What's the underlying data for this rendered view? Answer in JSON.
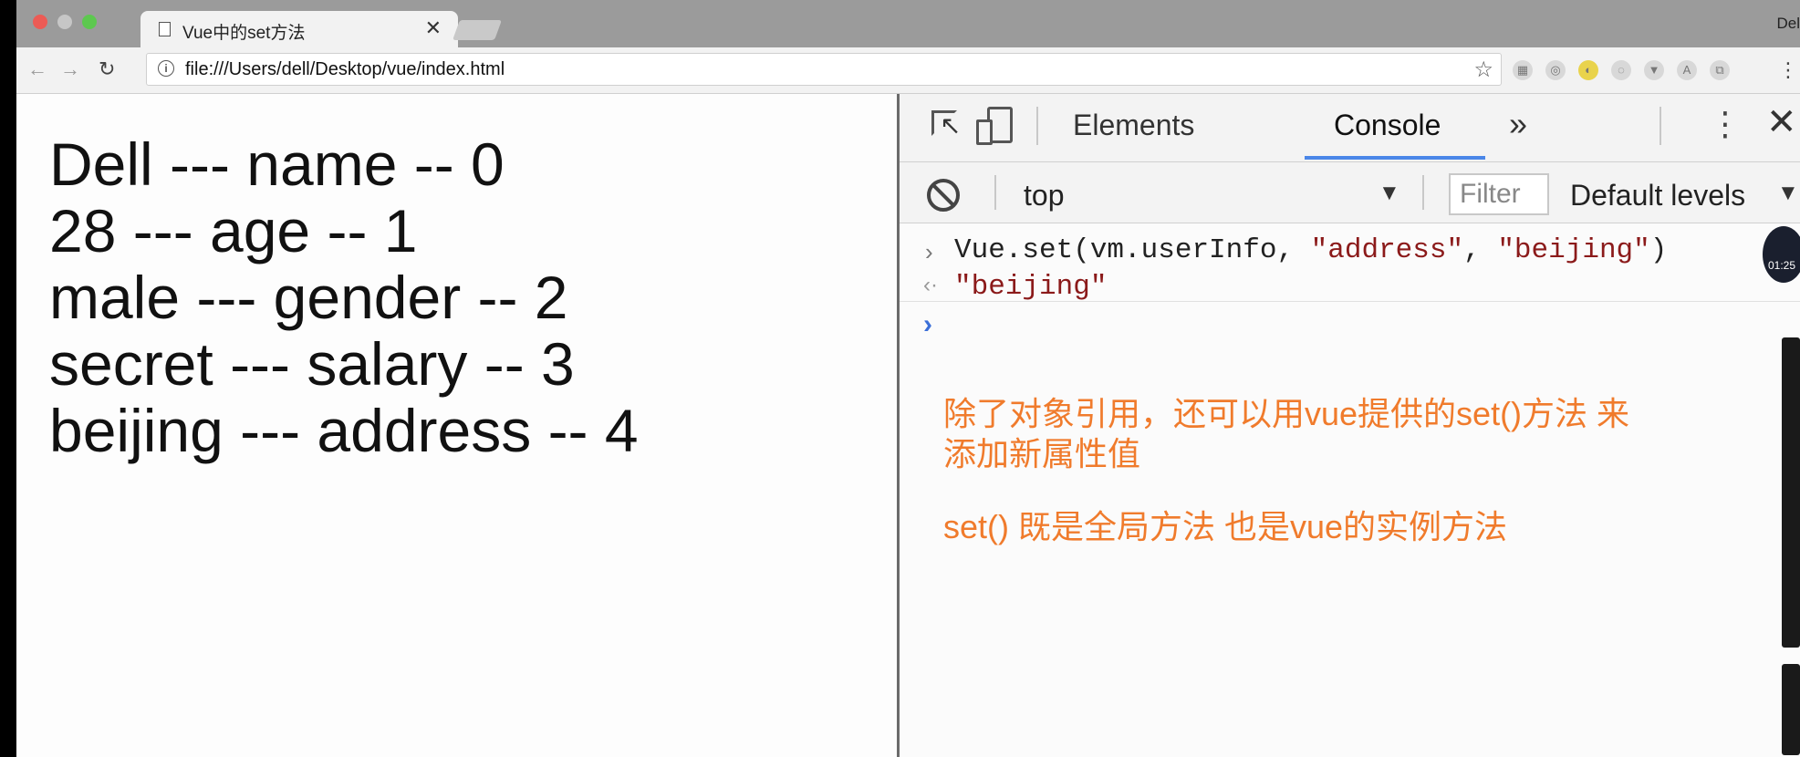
{
  "window": {
    "tab_title": "Vue中的set方法",
    "profile_label": "Del"
  },
  "toolbar": {
    "url": "file:///Users/dell/Desktop/vue/index.html"
  },
  "page": {
    "lines": [
      "Dell --- name -- 0",
      "28 --- age -- 1",
      "male --- gender -- 2",
      "secret --- salary -- 3",
      "beijing --- address -- 4"
    ]
  },
  "devtools": {
    "tabs": [
      "Elements",
      "Console"
    ],
    "active_tab": "Console",
    "context": "top",
    "filter_placeholder": "Filter",
    "levels": "Default levels",
    "console": {
      "input_prefix": "Vue.set(vm.userInfo, ",
      "input_arg1": "\"address\"",
      "input_comma": ", ",
      "input_arg2": "\"beijing\"",
      "input_suffix": ")",
      "output": "\"beijing\""
    },
    "notes": [
      "除了对象引用，还可以用vue提供的set()方法 来",
      "添加新属性值",
      "set() 既是全局方法 也是vue的实例方法"
    ],
    "notes_color": "#f07b2c"
  },
  "overlay": {
    "timer": "01:25"
  }
}
